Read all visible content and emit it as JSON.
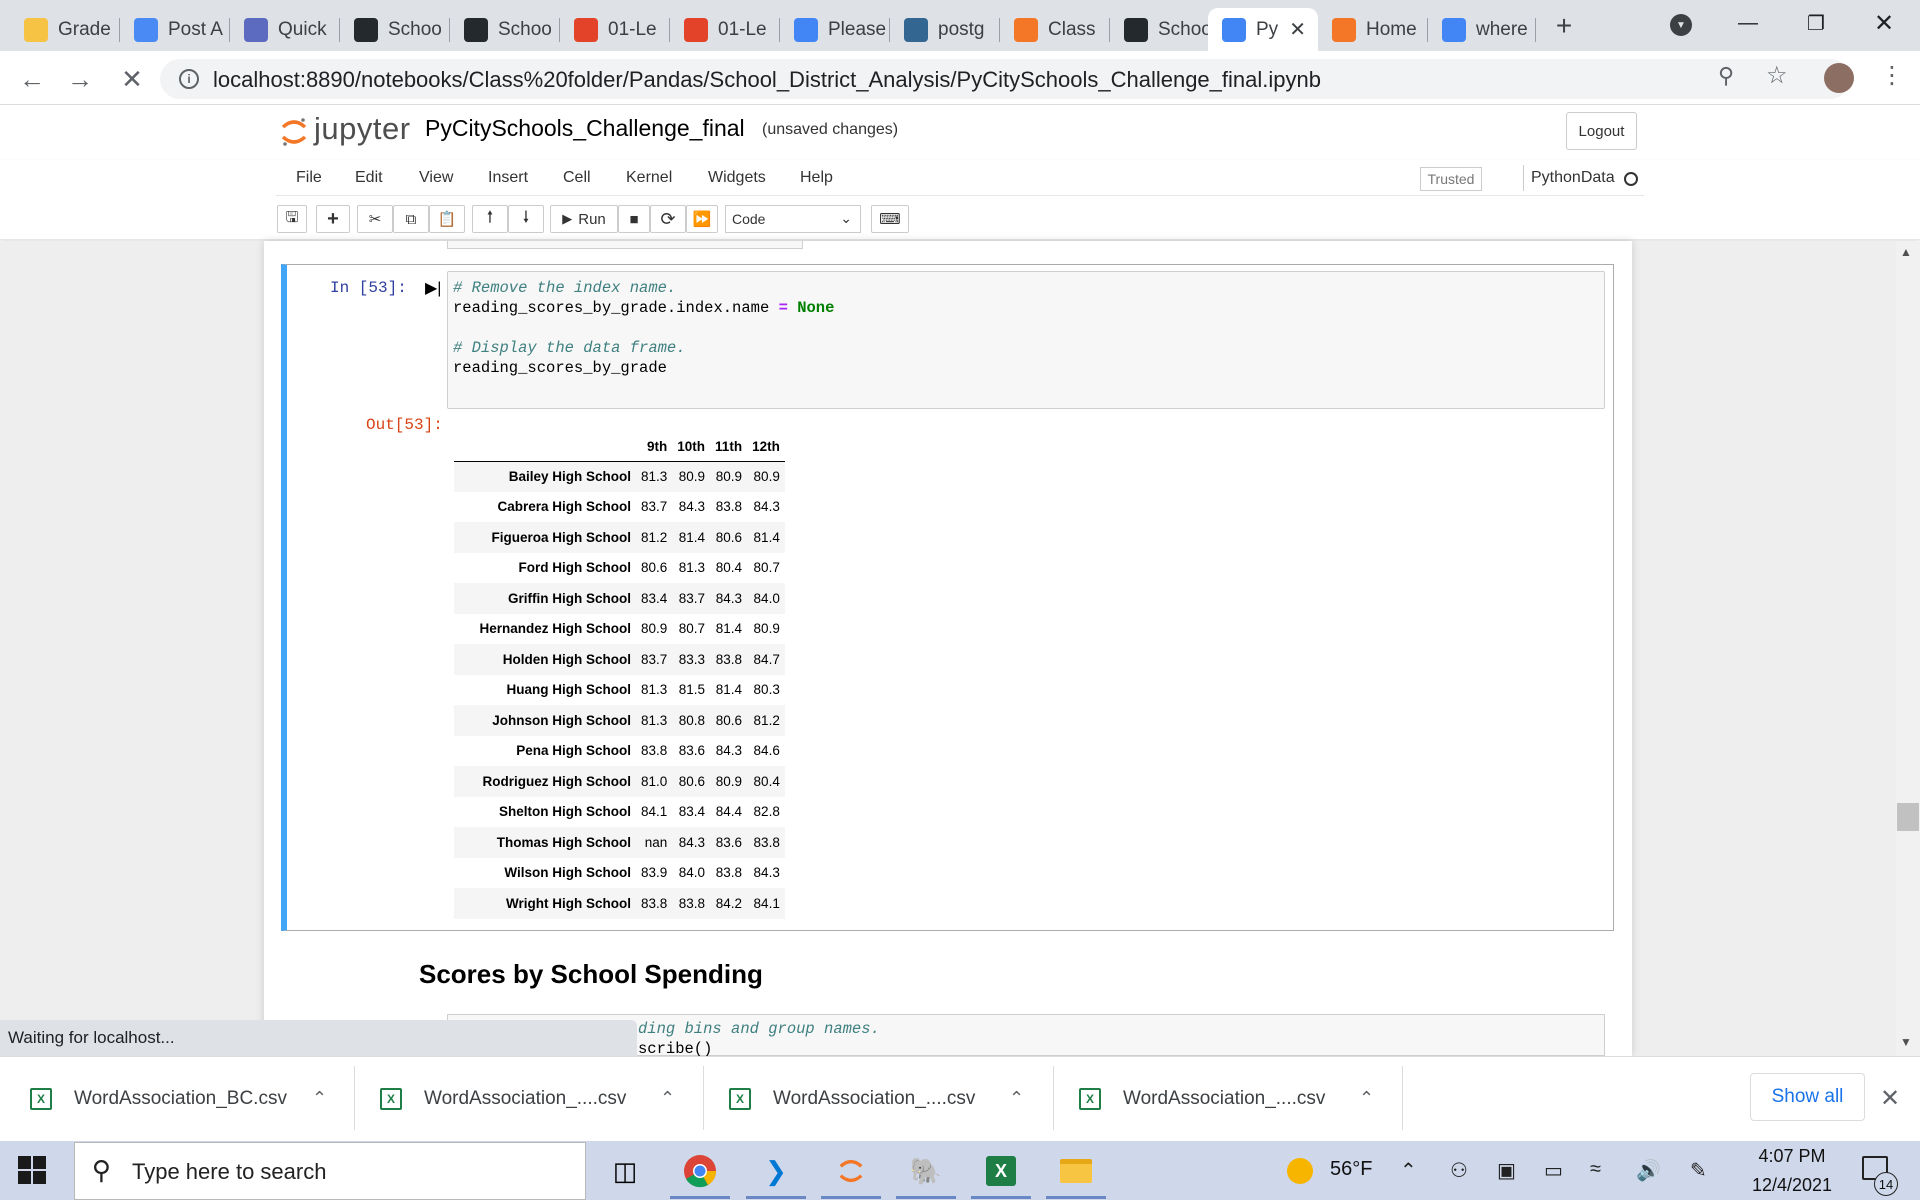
{
  "browser": {
    "tabs": [
      {
        "label": "Grade",
        "color": "#f6c344"
      },
      {
        "label": "Post A",
        "color": "#4a8af4"
      },
      {
        "label": "Quick",
        "color": "#5c6bc0"
      },
      {
        "label": "Schoo",
        "color": "#24292e"
      },
      {
        "label": "Schoo",
        "color": "#24292e"
      },
      {
        "label": "01-Le",
        "color": "#e24329"
      },
      {
        "label": "01-Le",
        "color": "#e24329"
      },
      {
        "label": "Please",
        "color": "#4285f4"
      },
      {
        "label": "postg",
        "color": "#336791"
      },
      {
        "label": "Class",
        "color": "#f37726"
      },
      {
        "label": "Schoo",
        "color": "#24292e"
      },
      {
        "label": "Py",
        "color": "#4285f4"
      },
      {
        "label": "Home",
        "color": "#f37726"
      },
      {
        "label": "where",
        "color": "#4285f4"
      }
    ],
    "url": "localhost:8890/notebooks/Class%20folder/Pandas/School_District_Analysis/PyCitySchools_Challenge_final.ipynb",
    "status_text": "Waiting for localhost..."
  },
  "jupyter": {
    "logo_text": "jupyter",
    "notebook_title": "PyCitySchools_Challenge_final",
    "save_status": "(unsaved changes)",
    "logout_label": "Logout",
    "menus": [
      "File",
      "Edit",
      "View",
      "Insert",
      "Cell",
      "Kernel",
      "Widgets",
      "Help"
    ],
    "trusted_label": "Trusted",
    "kernel_name": "PythonData",
    "run_label": "Run",
    "cell_type": "Code"
  },
  "cell": {
    "in_prompt": "In [53]:",
    "out_prompt": "Out[53]:",
    "code_lines": [
      {
        "type": "comment",
        "text": "# Remove the index name."
      },
      {
        "type": "code",
        "pre": "reading_scores_by_grade.index.name ",
        "op": "=",
        "kw": "None"
      },
      {
        "type": "blank",
        "text": ""
      },
      {
        "type": "comment",
        "text": "# Display the data frame."
      },
      {
        "type": "code_plain",
        "text": "reading_scores_by_grade"
      }
    ]
  },
  "dataframe": {
    "columns": [
      "9th",
      "10th",
      "11th",
      "12th"
    ],
    "rows": [
      {
        "school": "Bailey High School",
        "values": [
          "81.3",
          "80.9",
          "80.9",
          "80.9"
        ]
      },
      {
        "school": "Cabrera High School",
        "values": [
          "83.7",
          "84.3",
          "83.8",
          "84.3"
        ]
      },
      {
        "school": "Figueroa High School",
        "values": [
          "81.2",
          "81.4",
          "80.6",
          "81.4"
        ]
      },
      {
        "school": "Ford High School",
        "values": [
          "80.6",
          "81.3",
          "80.4",
          "80.7"
        ]
      },
      {
        "school": "Griffin High School",
        "values": [
          "83.4",
          "83.7",
          "84.3",
          "84.0"
        ]
      },
      {
        "school": "Hernandez High School",
        "values": [
          "80.9",
          "80.7",
          "81.4",
          "80.9"
        ]
      },
      {
        "school": "Holden High School",
        "values": [
          "83.7",
          "83.3",
          "83.8",
          "84.7"
        ]
      },
      {
        "school": "Huang High School",
        "values": [
          "81.3",
          "81.5",
          "81.4",
          "80.3"
        ]
      },
      {
        "school": "Johnson High School",
        "values": [
          "81.3",
          "80.8",
          "80.6",
          "81.2"
        ]
      },
      {
        "school": "Pena High School",
        "values": [
          "83.8",
          "83.6",
          "84.3",
          "84.6"
        ]
      },
      {
        "school": "Rodriguez High School",
        "values": [
          "81.0",
          "80.6",
          "80.9",
          "80.4"
        ]
      },
      {
        "school": "Shelton High School",
        "values": [
          "84.1",
          "83.4",
          "84.4",
          "82.8"
        ]
      },
      {
        "school": "Thomas High School",
        "values": [
          "nan",
          "84.3",
          "83.6",
          "83.8"
        ]
      },
      {
        "school": "Wilson High School",
        "values": [
          "83.9",
          "84.0",
          "83.8",
          "84.3"
        ]
      },
      {
        "school": "Wright High School",
        "values": [
          "83.8",
          "83.8",
          "84.2",
          "84.1"
        ]
      }
    ]
  },
  "next_section": {
    "heading": "Scores by School Spending",
    "code_line1": "ding bins and group names.",
    "code_line2": "scribe()"
  },
  "downloads": {
    "items": [
      "WordAssociation_BC.csv",
      "WordAssociation_....csv",
      "WordAssociation_....csv",
      "WordAssociation_....csv"
    ],
    "show_all": "Show all"
  },
  "taskbar": {
    "search_placeholder": "Type here to search",
    "weather": "56°F",
    "time": "4:07 PM",
    "date": "12/4/2021",
    "notification_count": "14"
  },
  "colors": {
    "cell_selected_border": "#42a5f5",
    "in_prompt": "#303f9f",
    "out_prompt": "#d84315",
    "comment": "#408080",
    "keyword": "#008000"
  }
}
